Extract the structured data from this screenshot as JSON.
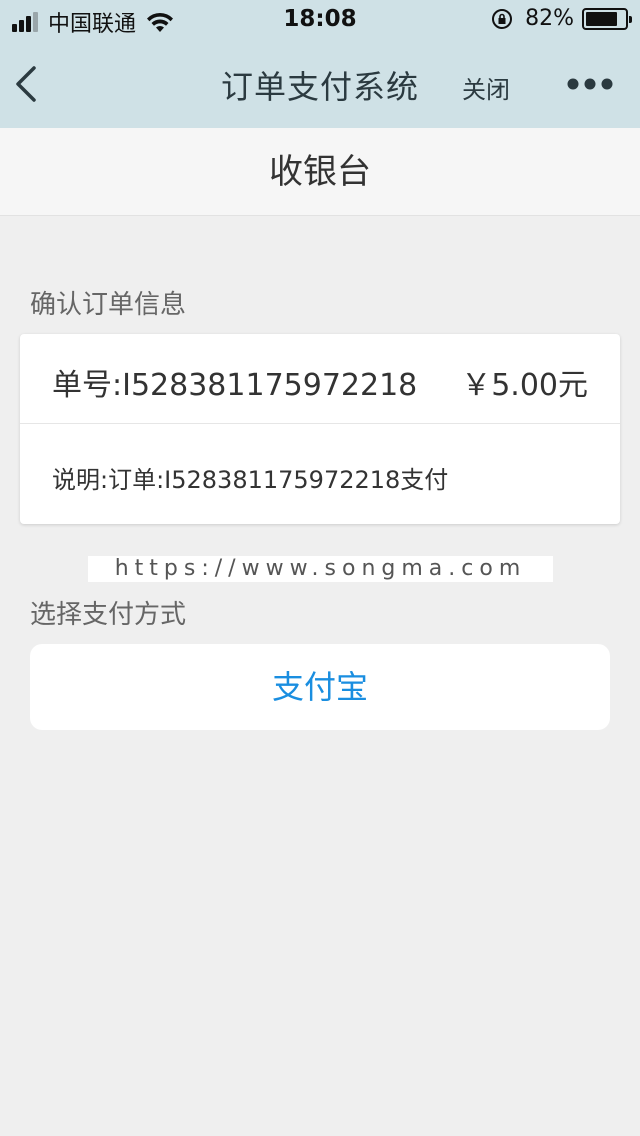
{
  "status_bar": {
    "carrier": "中国联通",
    "time": "18:08",
    "battery_percent": "82%",
    "battery_level": 0.82,
    "signal_bars": 4,
    "signal_bars_active": 3
  },
  "nav": {
    "title": "订单支付系统",
    "close_label": "关闭",
    "back_icon": "chevron-left-icon",
    "more_icon": "more-dots-icon"
  },
  "page": {
    "header": "收银台",
    "confirm_label": "确认订单信息",
    "payment_method_label": "选择支付方式"
  },
  "order": {
    "number": "单号:I528381175972218",
    "amount": "￥5.00元",
    "description": "说明:订单:I528381175972218支付"
  },
  "watermark": "https://www.songma.com",
  "payment_options": [
    {
      "label": "支付宝"
    }
  ],
  "colors": {
    "nav_bg": "#cfe1e6",
    "page_bg": "#efefef",
    "accent_blue": "#1a8ee0"
  }
}
